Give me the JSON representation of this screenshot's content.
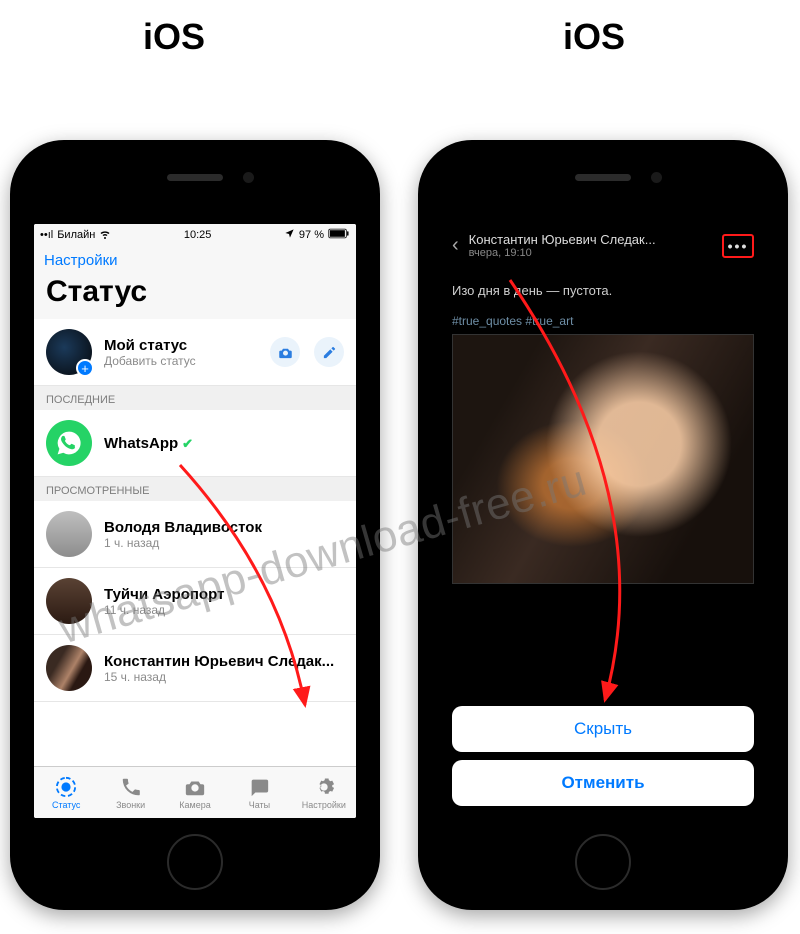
{
  "labels": {
    "ios": "iOS"
  },
  "watermark": "whatsapp-download-free.ru",
  "left": {
    "status_bar": {
      "carrier": "Билайн",
      "time": "10:25",
      "battery": "97 %"
    },
    "settings_link": "Настройки",
    "title": "Статус",
    "my_status": {
      "name": "Мой статус",
      "sub": "Добавить статус"
    },
    "section_recent": "ПОСЛЕДНИЕ",
    "whatsapp_row": {
      "name": "WhatsApp"
    },
    "section_viewed": "ПРОСМОТРЕННЫЕ",
    "contacts": [
      {
        "name": "Володя Владивосток",
        "sub": "1 ч. назад"
      },
      {
        "name": "Туйчи Аэропорт",
        "sub": "11 ч. назад"
      },
      {
        "name": "Константин Юрьевич Следак...",
        "sub": "15 ч. назад"
      }
    ],
    "tabs": {
      "status": "Статус",
      "calls": "Звонки",
      "camera": "Камера",
      "chats": "Чаты",
      "settings": "Настройки"
    }
  },
  "right": {
    "name": "Константин Юрьевич Следак...",
    "time": "вчера, 19:10",
    "caption": "Изо дня в день — пустота.",
    "tags": "#true_quotes #true_art",
    "hide": "Скрыть",
    "cancel": "Отменить"
  }
}
